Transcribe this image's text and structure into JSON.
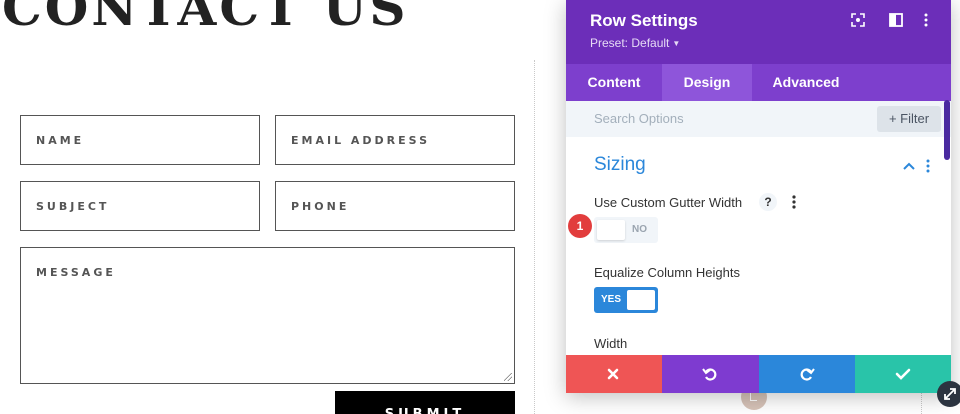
{
  "page": {
    "title": "CONTACT US",
    "form": {
      "name_placeholder": "NAME",
      "email_placeholder": "EMAIL ADDRESS",
      "subject_placeholder": "SUBJECT",
      "phone_placeholder": "PHONE",
      "message_placeholder": "MESSAGE",
      "submit_label": "SUBMIT"
    }
  },
  "modal": {
    "title": "Row Settings",
    "preset_label": "Preset: Default",
    "tabs": [
      {
        "label": "Content",
        "active": false
      },
      {
        "label": "Design",
        "active": true
      },
      {
        "label": "Advanced",
        "active": false
      }
    ],
    "search_placeholder": "Search Options",
    "filter_label": "+ Filter",
    "section_title": "Sizing",
    "options": {
      "gutter_label": "Use Custom Gutter Width",
      "gutter_help": "?",
      "gutter_toggle_text": "NO",
      "equalize_label": "Equalize Column Heights",
      "equalize_toggle_text": "YES",
      "width_label": "Width"
    },
    "badge_number": "1",
    "colors": {
      "header": "#6c2eb9",
      "tabs": "#7d3fcd",
      "accent_blue": "#2b87da",
      "cancel": "#ef5555",
      "undo": "#7e3bd0",
      "redo": "#2b87da",
      "save": "#29c4a9",
      "badge": "#e23d3d"
    },
    "footer_icons": [
      "close-icon",
      "undo-icon",
      "redo-icon",
      "check-icon"
    ]
  }
}
